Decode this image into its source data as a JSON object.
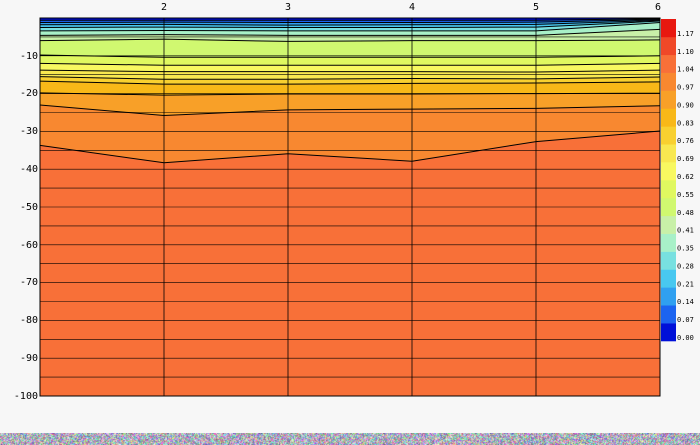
{
  "chart_data": {
    "type": "heatmap",
    "title": "",
    "xlabel": "",
    "ylabel": "",
    "xlim": [
      1,
      6
    ],
    "ylim": [
      -100,
      0
    ],
    "x_ticks": [
      "2",
      "3",
      "4",
      "5",
      "6"
    ],
    "y_ticks": [
      "-10",
      "-20",
      "-30",
      "-40",
      "-50",
      "-60",
      "-70",
      "-80",
      "-90",
      "-100"
    ],
    "grid": true,
    "colorbar": {
      "placement": "right",
      "levels": [
        "0.00",
        "0.07",
        "0.14",
        "0.21",
        "0.28",
        "0.35",
        "0.41",
        "0.48",
        "0.55",
        "0.62",
        "0.69",
        "0.76",
        "0.83",
        "0.90",
        "0.97",
        "1.04",
        "1.10",
        "1.17"
      ],
      "colors": [
        "#0010d8",
        "#1c64f0",
        "#30a0f0",
        "#48c8f0",
        "#78e0e0",
        "#a8f0c8",
        "#c8f0a8",
        "#d0f870",
        "#e0f860",
        "#f8f860",
        "#f8e850",
        "#f8d030",
        "#f8b818",
        "#f8a028",
        "#f88830",
        "#f87038",
        "#f04828",
        "#e81810"
      ]
    },
    "contour_x": [
      1,
      2,
      3,
      4,
      5,
      6
    ],
    "contours": [
      {
        "value": 0.07,
        "depth": [
          -0.6,
          -0.6,
          -0.6,
          -0.6,
          -0.6,
          -0.2
        ]
      },
      {
        "value": 0.14,
        "depth": [
          -1.2,
          -1.1,
          -1.2,
          -1.2,
          -1.1,
          -0.4
        ]
      },
      {
        "value": 0.21,
        "depth": [
          -1.8,
          -1.7,
          -1.9,
          -1.8,
          -1.7,
          -0.6
        ]
      },
      {
        "value": 0.28,
        "depth": [
          -2.5,
          -2.4,
          -2.5,
          -2.5,
          -2.4,
          -0.8
        ]
      },
      {
        "value": 0.35,
        "depth": [
          -3.4,
          -3.3,
          -3.4,
          -3.4,
          -3.4,
          -1.2
        ]
      },
      {
        "value": 0.41,
        "depth": [
          -4.6,
          -4.4,
          -4.6,
          -4.6,
          -4.6,
          -3.0
        ]
      },
      {
        "value": 0.48,
        "depth": [
          -6.0,
          -5.6,
          -6.2,
          -6.0,
          -6.0,
          -5.8
        ]
      },
      {
        "value": 0.55,
        "depth": [
          -9.8,
          -10.4,
          -10.4,
          -10.4,
          -10.4,
          -10.0
        ]
      },
      {
        "value": 0.62,
        "depth": [
          -12.0,
          -12.5,
          -12.5,
          -12.5,
          -12.5,
          -12.0
        ]
      },
      {
        "value": 0.69,
        "depth": [
          -13.8,
          -14.2,
          -14.2,
          -14.2,
          -14.3,
          -13.8
        ]
      },
      {
        "value": 0.76,
        "depth": [
          -15.5,
          -16.2,
          -16.2,
          -16.0,
          -16.1,
          -15.6
        ]
      },
      {
        "value": 0.83,
        "depth": [
          -16.7,
          -17.5,
          -17.5,
          -17.3,
          -17.2,
          -16.9
        ]
      },
      {
        "value": 0.9,
        "depth": [
          -19.8,
          -20.4,
          -20.1,
          -20.1,
          -20.0,
          -19.9
        ]
      },
      {
        "value": 0.97,
        "depth": [
          -23.0,
          -25.8,
          -24.3,
          -24.1,
          -23.9,
          -23.2
        ]
      },
      {
        "value": 1.04,
        "depth": [
          -33.7,
          -38.3,
          -35.9,
          -37.9,
          -32.7,
          -29.9
        ]
      }
    ]
  }
}
